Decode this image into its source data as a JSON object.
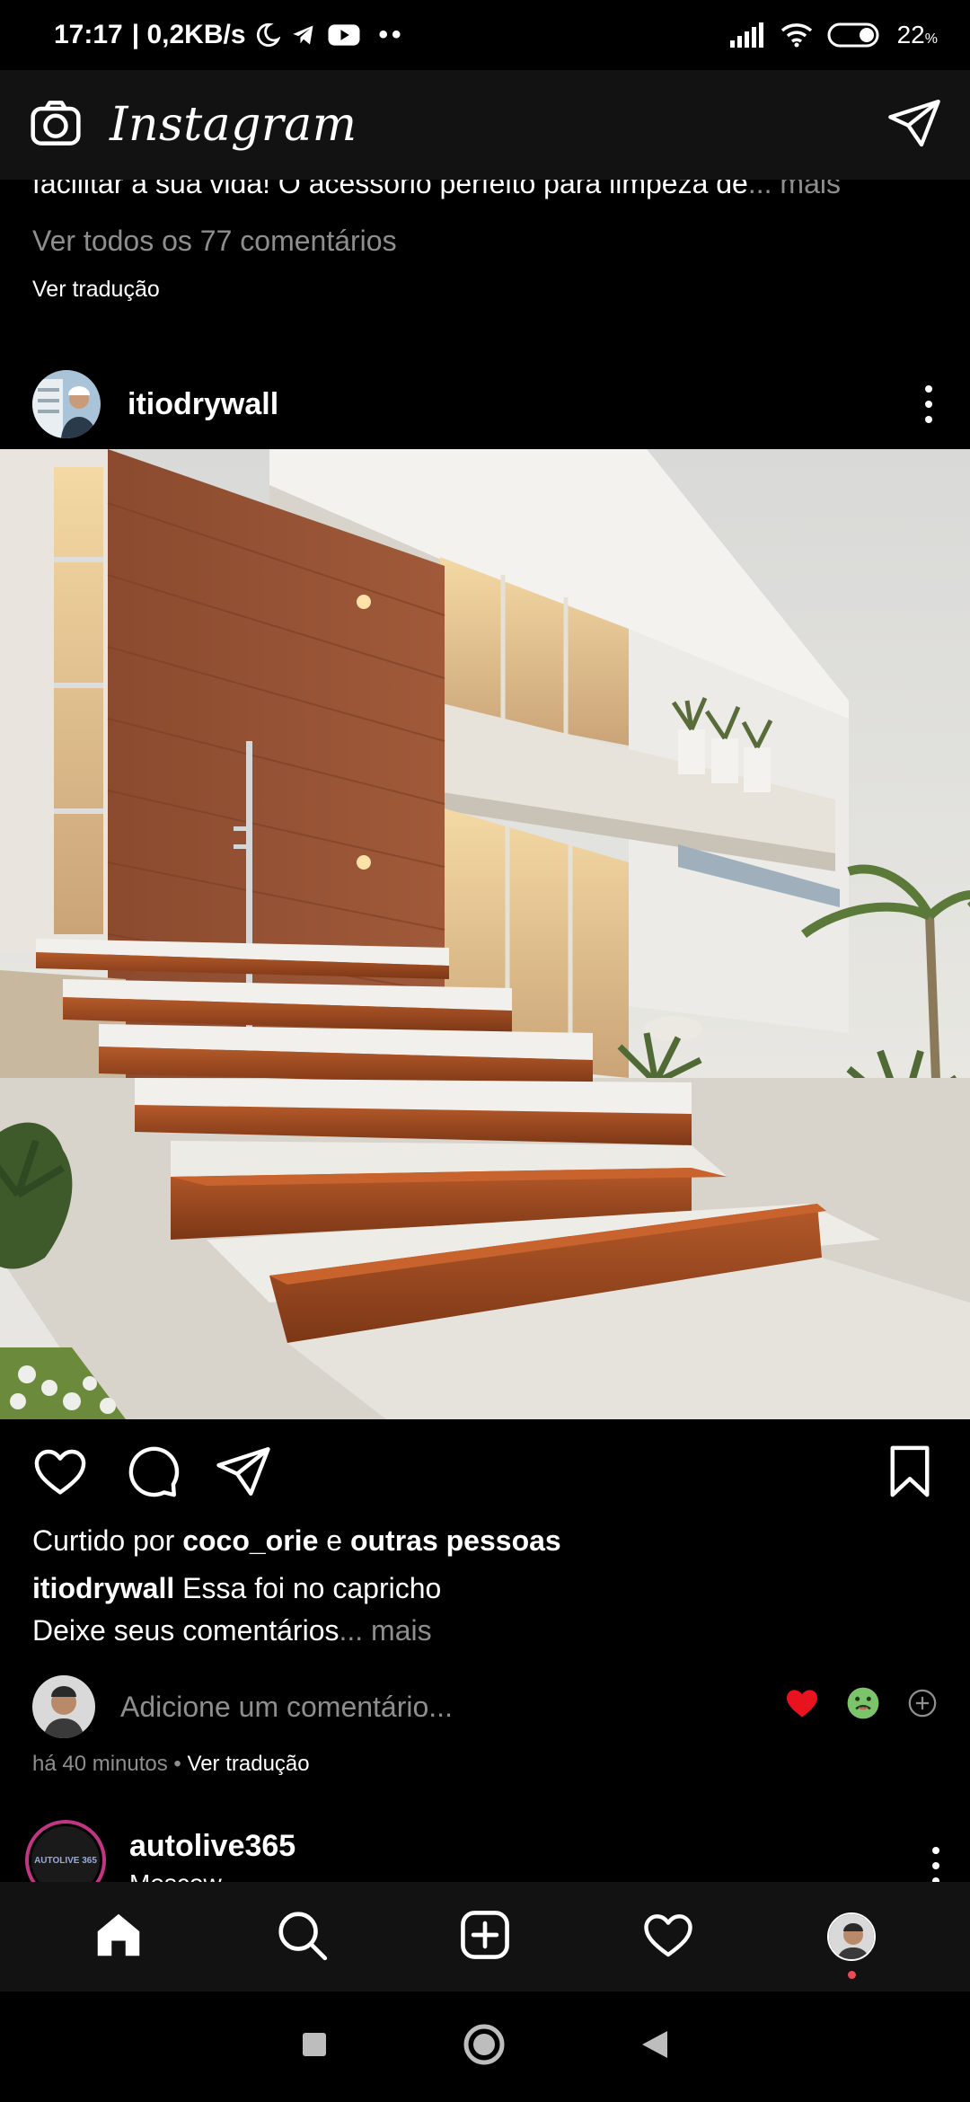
{
  "status_bar": {
    "time": "17:17",
    "speed": "| 0,2KB/s",
    "battery": "22"
  },
  "header": {
    "app_name": "Instagram"
  },
  "previous_post": {
    "caption": "facilitar a sua vida! O acessório perfeito para limpeza de",
    "caption_more": "... mais",
    "view_comments": "Ver todos os 77 comentários",
    "translate": "Ver tradução"
  },
  "post": {
    "username": "itiodrywall",
    "likes_prefix": "Curtido por ",
    "likes_user": "coco_orie",
    "likes_joiner": " e ",
    "likes_others": "outras pessoas",
    "caption_user": "itiodrywall",
    "caption_text": " Essa foi no capricho",
    "caption_line2": "Deixe seus comentários",
    "caption_more": "... mais",
    "comment_placeholder": "Adicione um comentário...",
    "reactions": [
      "heart-emoji",
      "nauseated-face-emoji"
    ],
    "time_ago": "há 40 minutos",
    "time_sep": " • ",
    "translate": "Ver tradução"
  },
  "next_post": {
    "username": "autolive365",
    "location": "Moscow",
    "avatar_text": "AUTOLIVE 365"
  },
  "colors": {
    "background": "#000000",
    "bar": "#121212",
    "muted": "#8e8e8e",
    "like_red": "#ed4956",
    "story_ring": "#c13584"
  },
  "icons": {
    "header_left": "camera-icon",
    "header_right": "direct-message-icon",
    "nav": [
      "home-icon",
      "search-icon",
      "add-post-icon",
      "activity-heart-icon",
      "profile-avatar"
    ]
  }
}
